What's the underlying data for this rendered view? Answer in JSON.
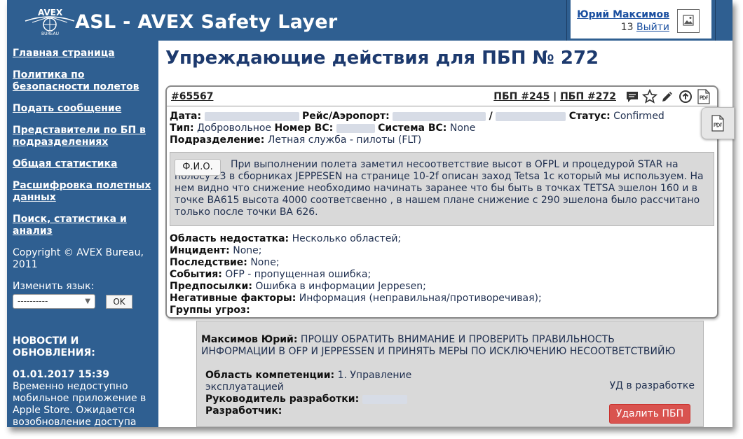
{
  "header": {
    "logo_text": "AVEX",
    "logo_sub": "BUREAU",
    "title": "ASL - AVEX Safety Layer"
  },
  "user": {
    "name": "Юрий Максимов",
    "count": "13",
    "logout": "Выйти"
  },
  "sidebar": {
    "items": [
      {
        "label": "Главная страница"
      },
      {
        "label": "Политика по безопасности полетов"
      },
      {
        "label": "Подать сообщение"
      },
      {
        "label": "Представители по БП в подразделениях"
      },
      {
        "label": "Общая статистика"
      },
      {
        "label": "Расшифровка полетных данных"
      },
      {
        "label": "Поиск, статистика и анализ"
      }
    ],
    "copyright": "Copyright © AVEX Bureau, 2011",
    "language_label": "Изменить язык:",
    "language_value": "----------",
    "ok_label": "OK",
    "news_title": "НОВОСТИ И ОБНОВЛЕНИЯ:",
    "news_date": "01.01.2017 15:39",
    "news_text": "Временно недоступно мобильное приложение в Apple Store. Ожидается возобновление доступа до"
  },
  "page": {
    "title": "Упреждающие действия для ПБП № 272"
  },
  "card": {
    "id": "#65567",
    "link1": "ПБП #245",
    "separator": "|",
    "link2": "ПБП #272",
    "date_label": "Дата:",
    "flight_label": "Рейс/Аэропорт:",
    "slash": "/",
    "status_label": "Статус:",
    "status_value": "Confirmed",
    "type_label": "Тип:",
    "type_value": "Добровольное",
    "aircraft_label": "Номер ВС:",
    "system_label": "Система ВС:",
    "system_value": "None",
    "division_label": "Подразделение:",
    "division_value": "Летная служба - пилоты (FLT)",
    "fio_button": "Ф.И.О.",
    "description": "При выполнении полета заметил несоответствие высот в OFPL и процедурой STAR на полосу 23 в сборниках JEPPESEN на странице 10-2f описан заход Tetsa 1c который мы используем. На нем видно что снижение необходимо начинать заранее что бы быть в точках TETSA эшелон 160 и в точке BA615 высота 4000 соответсвенно , в нашем плане снижение с 290 эшелона было рассчитано только после точки BA 626.",
    "area_label": "Область недостатка:",
    "area_value": "Несколько областей;",
    "incident_label": "Инцидент:",
    "incident_value": "None;",
    "consequence_label": "Последствие:",
    "consequence_value": "None;",
    "events_label": "События:",
    "events_value": "OFP - пропущенная ошибка;",
    "preconditions_label": "Предпосылки:",
    "preconditions_value": "Ошибка в информации Jeppesen;",
    "negative_label": "Негативные факторы:",
    "negative_value": "Информация (неправильная/противоречивая);",
    "threats_label": "Группы угроз:"
  },
  "reply": {
    "author": "Максимов Юрий:",
    "text": "ПРОШУ ОБРАТИТЬ ВНИМАНИЕ И ПРОВЕРИТЬ ПРАВИЛЬНОСТЬ ИНФОРМАЦИИ В OFP И JEPPESSEN И ПРИНЯТЬ МЕРЫ ПО ИСКЛЮЧЕНИЮ НЕСООТВЕТСТВИЙЮ",
    "competence_label": "Область компетенции:",
    "competence_value": "1. Управление эксплуатацией",
    "lead_label": "Руководитель разработки:",
    "developer_label": "Разработчик:",
    "status": "УД в разработке",
    "delete_button": "Удалить ПБП"
  },
  "icons": {
    "comment": "comment-icon",
    "star": "star-icon",
    "edit": "pencil-icon",
    "upload": "upload-icon",
    "pdf": "pdf-icon"
  },
  "colors": {
    "primary": "#2f5f91",
    "link": "#1a4fa0",
    "title": "#1d3a6e",
    "danger": "#d9534f",
    "panel": "#d9d9d9"
  }
}
